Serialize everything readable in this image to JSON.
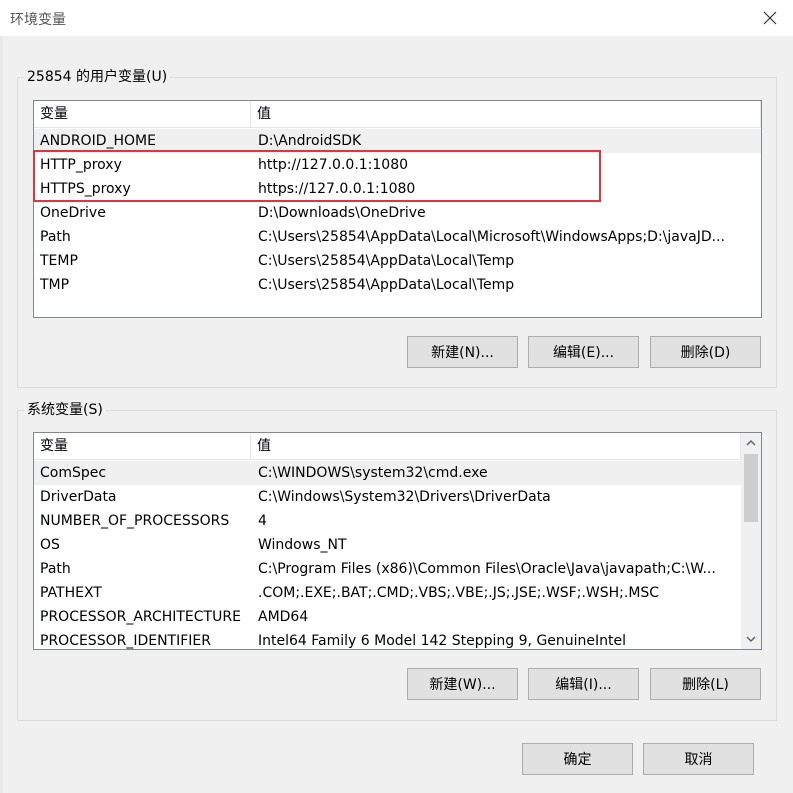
{
  "window": {
    "title": "环境变量"
  },
  "user_vars": {
    "group_label": "25854 的用户变量(U)",
    "col_name": "变量",
    "col_value": "值",
    "rows": [
      {
        "name": "ANDROID_HOME",
        "value": "D:\\AndroidSDK"
      },
      {
        "name": "HTTP_proxy",
        "value": "http://127.0.0.1:1080"
      },
      {
        "name": "HTTPS_proxy",
        "value": "https://127.0.0.1:1080"
      },
      {
        "name": "OneDrive",
        "value": "D:\\Downloads\\OneDrive"
      },
      {
        "name": "Path",
        "value": "C:\\Users\\25854\\AppData\\Local\\Microsoft\\WindowsApps;D:\\javaJD..."
      },
      {
        "name": "TEMP",
        "value": "C:\\Users\\25854\\AppData\\Local\\Temp"
      },
      {
        "name": "TMP",
        "value": "C:\\Users\\25854\\AppData\\Local\\Temp"
      }
    ],
    "new_label": "新建(N)...",
    "edit_label": "编辑(E)...",
    "delete_label": "删除(D)"
  },
  "system_vars": {
    "group_label": "系统变量(S)",
    "col_name": "变量",
    "col_value": "值",
    "rows": [
      {
        "name": "ComSpec",
        "value": "C:\\WINDOWS\\system32\\cmd.exe"
      },
      {
        "name": "DriverData",
        "value": "C:\\Windows\\System32\\Drivers\\DriverData"
      },
      {
        "name": "NUMBER_OF_PROCESSORS",
        "value": "4"
      },
      {
        "name": "OS",
        "value": "Windows_NT"
      },
      {
        "name": "Path",
        "value": "C:\\Program Files (x86)\\Common Files\\Oracle\\Java\\javapath;C:\\W..."
      },
      {
        "name": "PATHEXT",
        "value": ".COM;.EXE;.BAT;.CMD;.VBS;.VBE;.JS;.JSE;.WSF;.WSH;.MSC"
      },
      {
        "name": "PROCESSOR_ARCHITECTURE",
        "value": "AMD64"
      },
      {
        "name": "PROCESSOR_IDENTIFIER",
        "value": "Intel64 Family 6 Model 142 Stepping 9, GenuineIntel"
      }
    ],
    "new_label": "新建(W)...",
    "edit_label": "编辑(I)...",
    "delete_label": "删除(L)"
  },
  "footer": {
    "ok_label": "确定",
    "cancel_label": "取消"
  },
  "colors": {
    "highlight": "#e0353d",
    "selected_row": "#f0f0f0"
  }
}
